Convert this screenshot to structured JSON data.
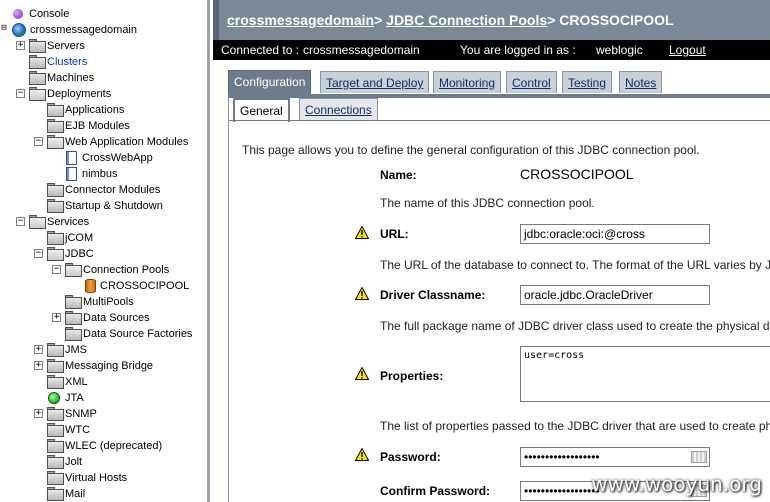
{
  "tree": {
    "console": "Console",
    "domain": "crossmessagedomain",
    "servers": "Servers",
    "clusters": "Clusters",
    "machines": "Machines",
    "deployments": "Deployments",
    "applications": "Applications",
    "ejb_modules": "EJB Modules",
    "web_app_modules": "Web Application Modules",
    "crosswebapp": "CrossWebApp",
    "nimbus": "nimbus",
    "connector_modules": "Connector Modules",
    "startup_shutdown": "Startup & Shutdown",
    "services": "Services",
    "jcom": "jCOM",
    "jdbc": "JDBC",
    "connection_pools": "Connection Pools",
    "crossocipool": "CROSSOCIPOOL",
    "multipools": "MultiPools",
    "data_sources": "Data Sources",
    "data_source_factories": "Data Source Factories",
    "jms": "JMS",
    "messaging_bridge": "Messaging Bridge",
    "xml": "XML",
    "jta": "JTA",
    "snmp": "SNMP",
    "wtc": "WTC",
    "wlec": "WLEC (deprecated)",
    "jolt": "Jolt",
    "virtual_hosts": "Virtual Hosts",
    "mail": "Mail"
  },
  "header": {
    "crumb_domain": "crossmessagedomain",
    "sep1": ">",
    "crumb_pools": "JDBC Connection Pools",
    "sep2": ">",
    "crumb_current": "CROSSOCIPOOL"
  },
  "status": {
    "connected_label": "Connected to :",
    "connected_value": "crossmessagedomain",
    "logged_label": "You are logged in as :",
    "logged_value": "weblogic",
    "logout": "Logout"
  },
  "tabs": {
    "configuration": "Configuration",
    "target_deploy": "Target and Deploy",
    "monitoring": "Monitoring",
    "control": "Control",
    "testing": "Testing",
    "notes": "Notes"
  },
  "subtabs": {
    "general": "General",
    "connections": "Connections"
  },
  "form": {
    "intro": "This page allows you to define the general configuration of this JDBC connection pool.",
    "name_label": "Name:",
    "name_value": "CROSSOCIPOOL",
    "name_desc": "The name of this JDBC connection pool.",
    "url_label": "URL:",
    "url_value": "jdbc:oracle:oci:@cross",
    "url_desc": "The URL of the database to connect to. The format of the URL varies by JDBC",
    "driver_label": "Driver Classname:",
    "driver_value": "oracle.jdbc.OracleDriver",
    "driver_desc": "The full package name of JDBC driver class used to create the physical data",
    "props_label": "Properties:",
    "props_value": "user=cross",
    "props_desc": "The list of properties passed to the JDBC driver that are used to create physi",
    "password_label": "Password:",
    "password_value": "••••••••••••••••••",
    "confirm_label": "Confirm Password:",
    "confirm_value": "••••••••••••••••••"
  },
  "watermark": "www.wooyun.org"
}
